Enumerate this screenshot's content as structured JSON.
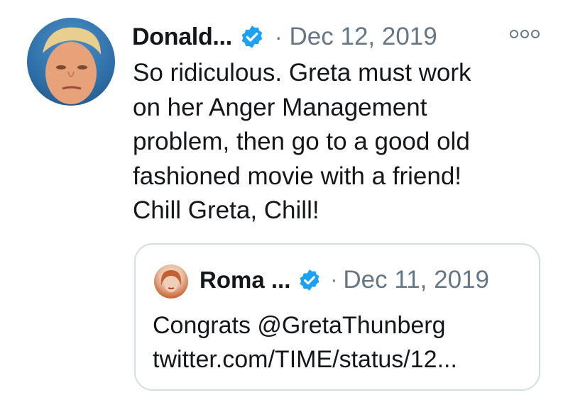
{
  "tweet": {
    "author_name": "Donald...",
    "verified": true,
    "separator": "·",
    "date": "Dec 12, 2019",
    "text": "So ridiculous. Greta must work\non her Anger Management\nproblem, then go to a good old\nfashioned movie with a friend!\nChill Greta, Chill!",
    "more_icon": "more-options-icon"
  },
  "quoted_tweet": {
    "author_name": "Roma ...",
    "verified": true,
    "separator": "·",
    "date": "Dec 11, 2019",
    "text": "Congrats @GretaThunberg\ntwitter.com/TIME/status/12..."
  },
  "colors": {
    "text": "#14171a",
    "muted": "#657786",
    "verified_blue": "#1da1f2",
    "card_border": "#d3dde5"
  }
}
